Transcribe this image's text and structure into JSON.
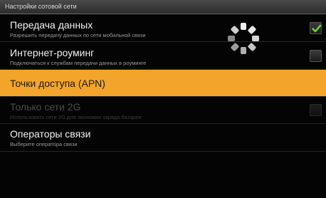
{
  "window": {
    "title": "Настройки сотовой сети"
  },
  "settings": [
    {
      "label": "Передача данных",
      "summary": "Разрешить передачу данных по сети мобильной связи",
      "checked": true,
      "enabled": true
    },
    {
      "label": "Интернет-роуминг",
      "summary": "Подключаться к службам передачи данных в роуминге",
      "checked": false,
      "enabled": true
    },
    {
      "label": "Точки доступа (APN)",
      "summary": "",
      "highlighted": true,
      "enabled": true
    },
    {
      "label": "Только сети 2G",
      "summary": "Использовать сети 2G для экономии заряда батареи",
      "checked": false,
      "enabled": false
    },
    {
      "label": "Операторы связи",
      "summary": "Выберите оператора связи",
      "enabled": true
    }
  ],
  "colors": {
    "highlight": "#f2a52a",
    "checkmark": "#6fd02a",
    "background": "#040404"
  },
  "icons": {
    "spinner": "loading-spinner-icon",
    "check": "checkmark-icon"
  }
}
